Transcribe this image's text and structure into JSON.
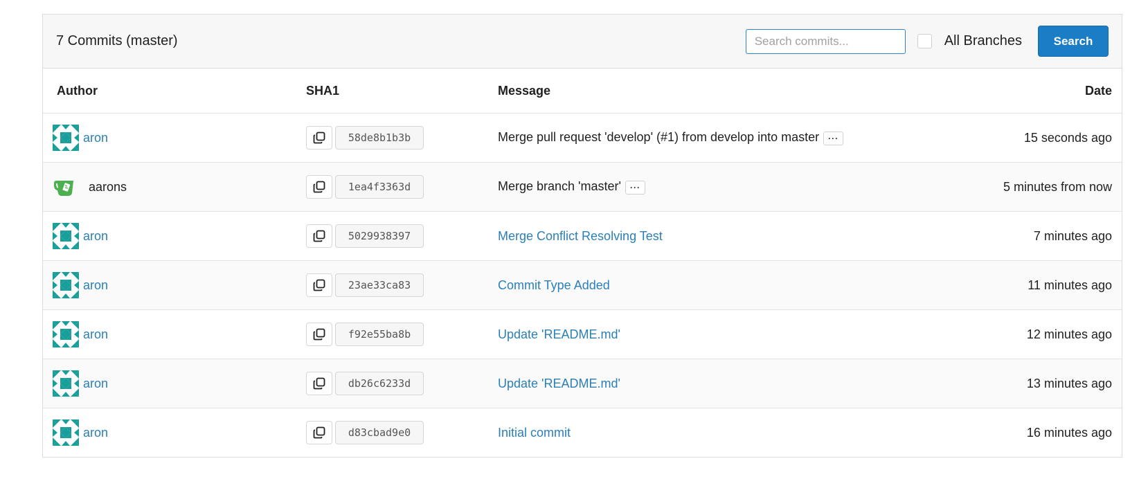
{
  "header": {
    "title": "7 Commits (master)",
    "search_placeholder": "Search commits...",
    "search_value": "",
    "all_branches_label": "All Branches",
    "search_button_label": "Search"
  },
  "table": {
    "columns": {
      "author": "Author",
      "sha": "SHA1",
      "message": "Message",
      "date": "Date"
    },
    "rows": [
      {
        "author": "aron",
        "sha": "58de8b1b3b",
        "message": "Merge pull request 'develop' (#1) from develop into master",
        "date": "15 seconds ago"
      },
      {
        "author": "aarons",
        "sha": "1ea4f3363d",
        "message": "Merge branch 'master'",
        "date": "5 minutes from now"
      },
      {
        "author": "aron",
        "sha": "5029938397",
        "message": "Merge Conflict Resolving Test",
        "date": "7 minutes ago"
      },
      {
        "author": "aron",
        "sha": "23ae33ca83",
        "message": "Commit Type Added",
        "date": "11 minutes ago"
      },
      {
        "author": "aron",
        "sha": "f92e55ba8b",
        "message": "Update 'README.md'",
        "date": "12 minutes ago"
      },
      {
        "author": "aron",
        "sha": "db26c6233d",
        "message": "Update 'README.md'",
        "date": "13 minutes ago"
      },
      {
        "author": "aron",
        "sha": "d83cbad9e0",
        "message": "Initial commit",
        "date": "16 minutes ago"
      }
    ],
    "ellipsis_label": "···"
  },
  "colors": {
    "accent": "#1a7dc6",
    "link": "#2b7fb8",
    "avatar_teal": "#1a9e9a",
    "gitea_green": "#4caf50"
  },
  "icons": [
    "identicon-avatar",
    "gitea-logo-icon",
    "copy-icon"
  ]
}
